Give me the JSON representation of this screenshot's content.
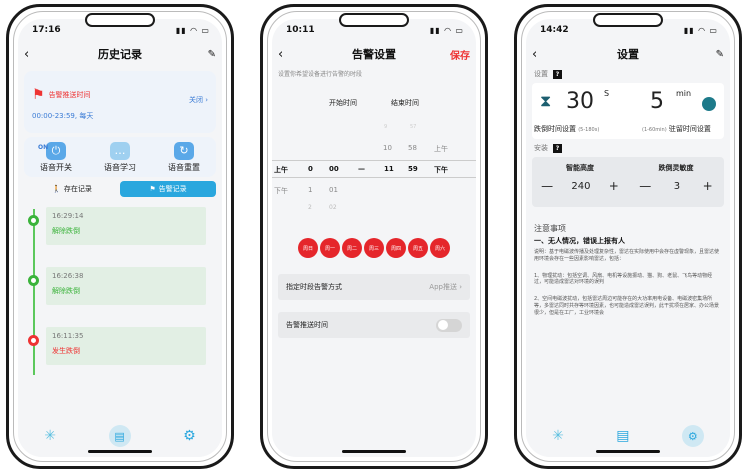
{
  "phone1": {
    "time": "17:16",
    "title": "历史记录",
    "alarm": {
      "label": "告警推送时间",
      "range": "00:00-23:59, 每天",
      "action": "关闭"
    },
    "quick": {
      "on_label": "ON",
      "items": [
        "语音开关",
        "语音学习",
        "语音重置"
      ]
    },
    "tabs": [
      "存在记录",
      "告警记录"
    ],
    "timeline": [
      {
        "time": "16:29:14",
        "event": "解除跌倒",
        "status": "green"
      },
      {
        "time": "16:26:38",
        "event": "解除跌倒",
        "status": "green"
      },
      {
        "time": "16:11:35",
        "event": "发生跌倒",
        "status": "red"
      }
    ]
  },
  "phone2": {
    "time": "10:11",
    "title": "告警设置",
    "save": "保存",
    "hint": "设置你希望设备进行告警的时段",
    "start_label": "开始时间",
    "end_label": "结束时间",
    "wheel": {
      "sel_start": [
        "上午",
        "0",
        "00"
      ],
      "sel_end": [
        "11",
        "59",
        "下午"
      ],
      "dash": "—",
      "above_end": [
        [
          "9",
          "57"
        ],
        [
          "10",
          "58",
          "上午"
        ]
      ],
      "below_start": [
        [
          "下午",
          "1",
          "01"
        ],
        [
          "",
          "2",
          "02"
        ]
      ]
    },
    "days": [
      "周日",
      "周一",
      "周二",
      "周三",
      "周四",
      "周五",
      "周六"
    ],
    "push_mode_label": "指定时段告警方式",
    "push_mode_value": "App推送",
    "push_time_label": "告警推送时间"
  },
  "phone3": {
    "time": "14:42",
    "title": "设置",
    "sec_settings": "设置",
    "sec_install": "安装",
    "fall_value": "30",
    "fall_unit": "S",
    "fall_label": "跌倒时间设置",
    "fall_range": "(5-180s)",
    "stay_value": "5",
    "stay_unit": "min",
    "stay_label": "驻留时间设置",
    "stay_range": "(1-60min)",
    "height_label": "智能高度",
    "height_value": "240",
    "sens_label": "跌倒灵敏度",
    "sens_value": "3",
    "notes_title": "注意事项",
    "notes_head": "一、无人情况，错误上报有人",
    "notes_p1": "说明：基于电磁波传播及处理复杂性，雷达在实际使用中会存在虚警现象，且雷达使用环境会存在一些因素影响雷达，包括：",
    "notes_p2": "1、物理扰动：包括空调、风扇、电机等设施振动、猫、狗、老鼠、飞鸟等动物经过，可能造成雷达对环境的误判",
    "notes_p3": "2、空间电磁波扰动，包括雷达周边可能存在的大功率用电设备、电磁波密集场所等，多雷达同时共存等环境因素，也可能造成雷达误判，此干扰项在居家、办公场景很少，但是在工厂，工业环境会"
  }
}
